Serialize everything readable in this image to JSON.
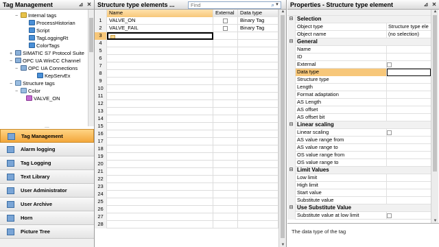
{
  "left": {
    "title": "Tag Management",
    "tree": [
      {
        "label": "Internal tags",
        "icon": "folder-icon",
        "expander": "−"
      },
      {
        "label": "ProcessHistorian",
        "icon": "table-icon",
        "expander": ""
      },
      {
        "label": "Script",
        "icon": "table-icon",
        "expander": ""
      },
      {
        "label": "TagLoggingRt",
        "icon": "table-icon",
        "expander": ""
      },
      {
        "label": "ColorTags",
        "icon": "table-icon",
        "expander": ""
      },
      {
        "label": "SIMATIC S7 Protocol Suite",
        "icon": "plug-icon",
        "expander": "+"
      },
      {
        "label": "OPC UA WinCC Channel",
        "icon": "plug-icon",
        "expander": "−"
      },
      {
        "label": "OPC UA Connections",
        "icon": "plug-icon",
        "expander": "−"
      },
      {
        "label": "KepServEx",
        "icon": "table-icon",
        "expander": ""
      },
      {
        "label": "Structure tags",
        "icon": "structure-icon",
        "expander": "−"
      },
      {
        "label": "Color",
        "icon": "structure-icon",
        "expander": "−"
      },
      {
        "label": "VALVE_ON",
        "icon": "tag-icon",
        "expander": ""
      }
    ],
    "splitter": "....",
    "nav": [
      {
        "label": "Tag Management",
        "icon": "tag-management-icon",
        "active": true
      },
      {
        "label": "Alarm logging",
        "icon": "alarm-logging-icon"
      },
      {
        "label": "Tag Logging",
        "icon": "tag-logging-icon"
      },
      {
        "label": "Text Library",
        "icon": "text-library-icon"
      },
      {
        "label": "User Administrator",
        "icon": "user-administrator-icon"
      },
      {
        "label": "User Archive",
        "icon": "user-archive-icon"
      },
      {
        "label": "Horn",
        "icon": "horn-icon"
      },
      {
        "label": "Picture Tree",
        "icon": "picture-tree-icon"
      }
    ]
  },
  "middle": {
    "title": "Structure type elements ...",
    "find_placeholder": "Find",
    "columns": {
      "name": "Name",
      "external": "External",
      "datatype": "Data type"
    },
    "rows": [
      {
        "n": "1",
        "name": "VALVE_ON",
        "datatype": "Binary Tag"
      },
      {
        "n": "2",
        "name": "VALVE_FAIL",
        "datatype": "Binary Tag"
      },
      {
        "n": "3",
        "name": "",
        "datatype": ""
      },
      {
        "n": "4"
      },
      {
        "n": "5"
      },
      {
        "n": "6"
      },
      {
        "n": "7"
      },
      {
        "n": "8"
      },
      {
        "n": "9"
      },
      {
        "n": "10"
      },
      {
        "n": "11"
      },
      {
        "n": "12"
      },
      {
        "n": "13"
      },
      {
        "n": "14"
      },
      {
        "n": "15"
      },
      {
        "n": "16"
      },
      {
        "n": "17"
      },
      {
        "n": "18"
      },
      {
        "n": "19"
      },
      {
        "n": "20"
      },
      {
        "n": "21"
      },
      {
        "n": "22"
      },
      {
        "n": "23"
      },
      {
        "n": "24"
      },
      {
        "n": "25"
      },
      {
        "n": "26"
      },
      {
        "n": "27"
      },
      {
        "n": "28"
      }
    ]
  },
  "right": {
    "title": "Properties - Structure type element",
    "rows": [
      {
        "type": "cat",
        "label": "Selection"
      },
      {
        "label": "Object type",
        "value": "Structure type ele"
      },
      {
        "label": "Object name",
        "value": "(no selection)"
      },
      {
        "type": "cat",
        "label": "General"
      },
      {
        "label": "Name",
        "value": ""
      },
      {
        "label": "ID",
        "value": ""
      },
      {
        "label": "External",
        "value": "",
        "check": true
      },
      {
        "label": "Data type",
        "value": "",
        "selected": true
      },
      {
        "label": "Structure type",
        "value": ""
      },
      {
        "label": "Length",
        "value": ""
      },
      {
        "label": "Format adaptation",
        "value": ""
      },
      {
        "label": "AS Length",
        "value": ""
      },
      {
        "label": "AS offset",
        "value": ""
      },
      {
        "label": "AS offset bit",
        "value": ""
      },
      {
        "type": "cat",
        "label": "Linear scaling"
      },
      {
        "label": "Linear scaling",
        "value": "",
        "check": true
      },
      {
        "label": "AS value range from",
        "value": ""
      },
      {
        "label": "AS value range to",
        "value": ""
      },
      {
        "label": "OS value range from",
        "value": ""
      },
      {
        "label": "OS value range to",
        "value": ""
      },
      {
        "type": "cat",
        "label": "Limit Values"
      },
      {
        "label": "Low limit",
        "value": ""
      },
      {
        "label": "High limit",
        "value": ""
      },
      {
        "label": "Start value",
        "value": ""
      },
      {
        "label": "Substitute value",
        "value": ""
      },
      {
        "type": "cat",
        "label": "Use Substitute Value"
      },
      {
        "label": "Substitute value at low limit",
        "value": "",
        "check": true
      }
    ],
    "description": "The data type of the tag"
  }
}
